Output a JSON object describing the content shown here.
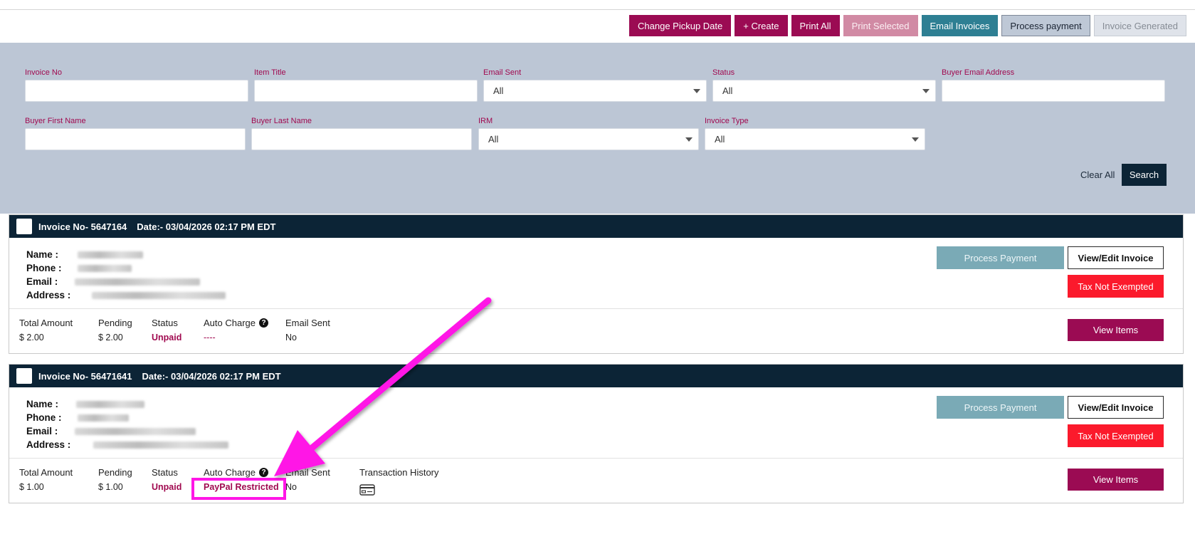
{
  "toolbar": {
    "change_pickup": "Change Pickup Date",
    "create": "+ Create",
    "print_all": "Print All",
    "print_selected": "Print Selected",
    "email_invoices": "Email Invoices",
    "process_payment": "Process payment",
    "invoice_generated": "Invoice Generated"
  },
  "filters": {
    "invoice_no": {
      "label": "Invoice No",
      "value": ""
    },
    "item_title": {
      "label": "Item Title",
      "value": ""
    },
    "email_sent": {
      "label": "Email Sent",
      "value": "All"
    },
    "status": {
      "label": "Status",
      "value": "All"
    },
    "buyer_email": {
      "label": "Buyer Email Address",
      "value": ""
    },
    "buyer_first": {
      "label": "Buyer First Name",
      "value": ""
    },
    "buyer_last": {
      "label": "Buyer Last Name",
      "value": ""
    },
    "irm": {
      "label": "IRM",
      "value": "All"
    },
    "invoice_type": {
      "label": "Invoice Type",
      "value": "All"
    },
    "clear_all": "Clear All",
    "search": "Search"
  },
  "labels": {
    "name": "Name :",
    "phone": "Phone :",
    "email": "Email :",
    "address": "Address :",
    "total_amount": "Total Amount",
    "pending": "Pending",
    "status": "Status",
    "auto_charge": "Auto Charge",
    "email_sent": "Email Sent",
    "transaction_history": "Transaction History",
    "process_payment": "Process Payment",
    "view_edit": "View/Edit Invoice",
    "tax": "Tax Not Exempted",
    "view_items": "View Items"
  },
  "invoices": [
    {
      "number": "Invoice No- 5647164",
      "date": "Date:- 03/04/2026 02:17 PM EDT",
      "total": "$ 2.00",
      "pending": "$ 2.00",
      "status": "Unpaid",
      "auto_charge": "----",
      "email_sent": "No"
    },
    {
      "number": "Invoice No- 56471641",
      "date": "Date:- 03/04/2026 02:17 PM EDT",
      "total": "$ 1.00",
      "pending": "$ 1.00",
      "status": "Unpaid",
      "auto_charge": "PayPal Restricted",
      "email_sent": "No"
    }
  ],
  "colors": {
    "maroon": "#9b0b53",
    "navy": "#0c2436",
    "filter_bg": "#bcc6d5",
    "teal": "#2e7f93",
    "highlight": "#ff16e6",
    "tax_red": "#fb1a2c"
  }
}
